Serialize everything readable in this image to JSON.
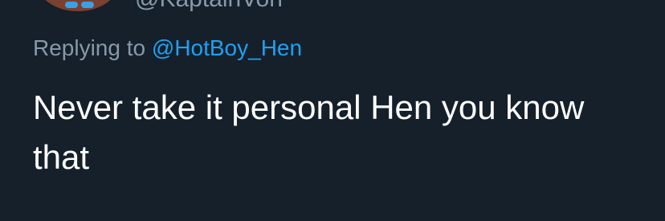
{
  "author": {
    "handle": "@KaptainVon"
  },
  "reply": {
    "prefix": "Replying to ",
    "mention": "@HotBoy_Hen"
  },
  "tweet": {
    "text": "Never take it personal Hen you know that"
  },
  "colors": {
    "background": "#15202b",
    "secondary_text": "#8899a6",
    "mention": "#1da1f2",
    "primary_text": "#ffffff"
  }
}
